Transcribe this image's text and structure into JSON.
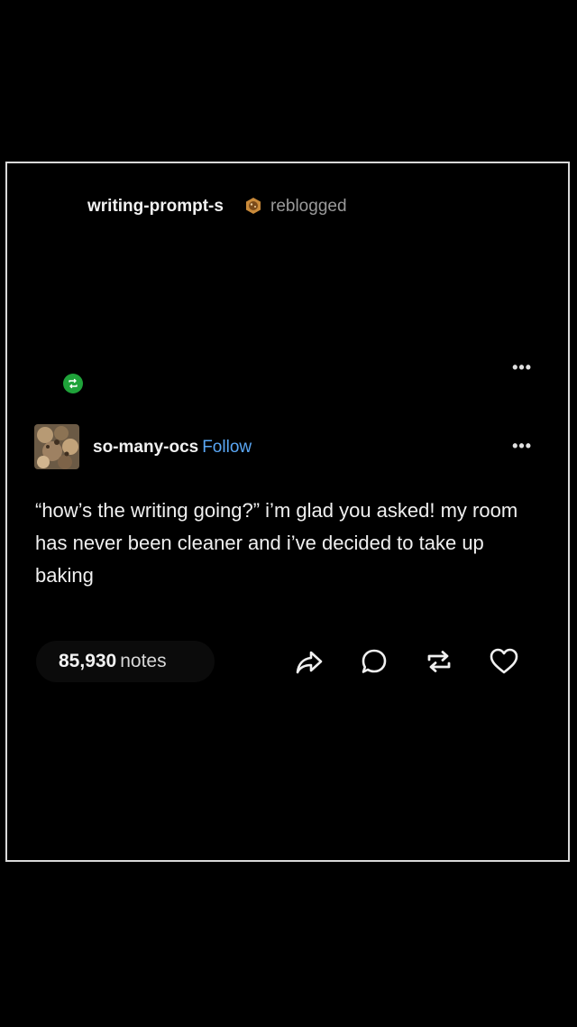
{
  "post": {
    "reblog": {
      "username": "writing-prompt-s",
      "action_text": "reblogged",
      "badge_icon": "cookie-badge-icon",
      "reblog_icon": "reblog-icon",
      "badge_color": "#1fa33a"
    },
    "author": {
      "username": "so-many-ocs",
      "follow_label": "Follow",
      "follow_color": "#5aa7f5"
    },
    "body": "“how’s the writing going?” i’m glad you asked! my room has never been cleaner and i’ve decided to take up baking",
    "notes": {
      "count": "85,930",
      "label": "notes"
    },
    "more_label": "•••",
    "actions": [
      {
        "name": "share",
        "icon": "share-icon"
      },
      {
        "name": "reply",
        "icon": "reply-icon"
      },
      {
        "name": "reblog",
        "icon": "reblog-icon"
      },
      {
        "name": "like",
        "icon": "heart-icon"
      }
    ]
  }
}
